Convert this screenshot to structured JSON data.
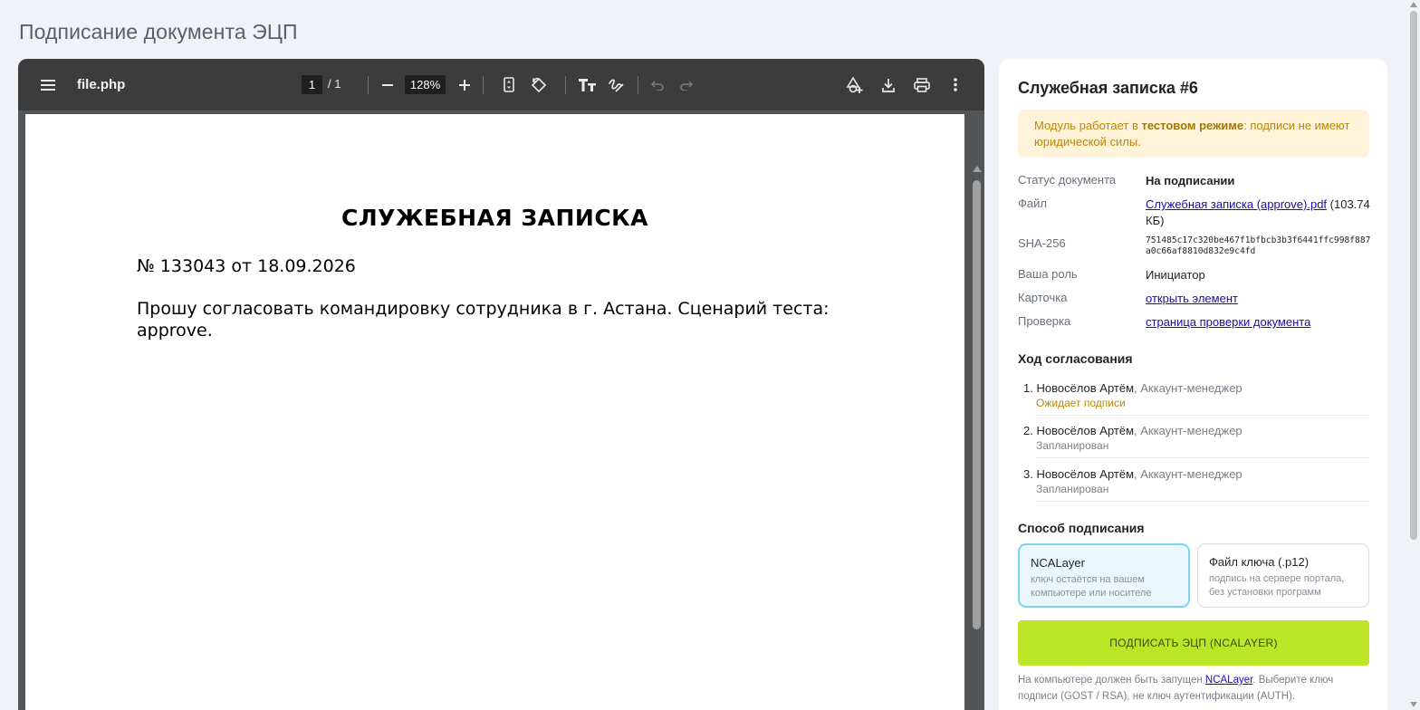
{
  "page": {
    "title": "Подписание документа ЭЦП"
  },
  "viewer": {
    "filename": "file.php",
    "page_current": "1",
    "page_total": "/  1",
    "zoom": "128%",
    "icons": [
      "menu-icon",
      "zoom-out-icon",
      "zoom-in-icon",
      "fit-page-icon",
      "rotate-icon",
      "text-icon",
      "draw-icon",
      "undo-icon",
      "redo-icon",
      "annotate-icon",
      "download-icon",
      "print-icon",
      "more-icon"
    ]
  },
  "document": {
    "heading": "СЛУЖЕБНАЯ ЗАПИСКА",
    "number": "№ 133043 от 18.09.2026",
    "body": "Прошу согласовать командировку сотрудника в г. Астана. Сценарий теста: approve."
  },
  "panel": {
    "title": "Служебная записка #6",
    "alert_prefix": "Модуль работает в ",
    "alert_bold": "тестовом режиме",
    "alert_suffix": ": подписи не имеют юридической силы.",
    "info": {
      "status_label": "Статус документа",
      "status_value": "На подписании",
      "file_label": "Файл",
      "file_link": "Служебная записка (approve).pdf",
      "file_size": " (103.74 КБ)",
      "sha_label": "SHA-256",
      "sha_value": "751485c17c320be467f1bfbcb3b3f6441ffc998f887a0c66af8810d832e9c4fd",
      "role_label": "Ваша роль",
      "role_value": "Инициатор",
      "card_label": "Карточка",
      "card_link": "открыть элемент",
      "check_label": "Проверка",
      "check_link": "страница проверки документа"
    },
    "approval_title": "Ход согласования",
    "steps": [
      {
        "num": "1.",
        "name": "Новосёлов Артём",
        "role": ", Аккаунт-менеджер",
        "state": "Ожидает подписи",
        "state_color": "#b8860b"
      },
      {
        "num": "2.",
        "name": "Новосёлов Артём",
        "role": ", Аккаунт-менеджер",
        "state": "Запланирован",
        "state_color": "#7a8088"
      },
      {
        "num": "3.",
        "name": "Новосёлов Артём",
        "role": ", Аккаунт-менеджер",
        "state": "Запланирован",
        "state_color": "#7a8088"
      }
    ],
    "method_title": "Способ подписания",
    "methods": [
      {
        "title": "NCALayer",
        "desc": "ключ остаётся на вашем компьютере или носителе"
      },
      {
        "title": "Файл ключа (.p12)",
        "desc": "подпись на сервере портала, без установки программ"
      }
    ],
    "sign_button": "ПОДПИСАТЬ ЭЦП (NCALAYER)",
    "hint_prefix": "На компьютере должен быть запущен ",
    "hint_link": "NCALayer",
    "hint_suffix": ". Выберите ключ подписи (GOST / RSA), не ключ аутентификации (AUTH)."
  }
}
